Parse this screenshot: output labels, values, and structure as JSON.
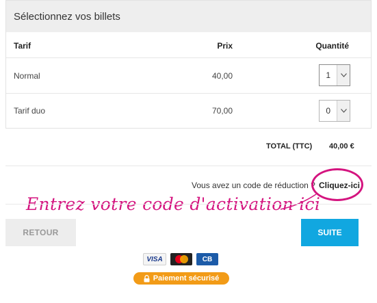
{
  "header": {
    "title": "Sélectionnez vos billets"
  },
  "table": {
    "columns": {
      "tarif": "Tarif",
      "prix": "Prix",
      "quantite": "Quantité"
    },
    "rows": [
      {
        "tarif": "Normal",
        "prix": "40,00",
        "quantite": "1"
      },
      {
        "tarif": "Tarif duo",
        "prix": "70,00",
        "quantite": "0"
      }
    ]
  },
  "total": {
    "label": "TOTAL (TTC)",
    "value": "40,00 €"
  },
  "promo": {
    "text": "Vous avez un code de réduction ?",
    "link": "Cliquez-ici",
    "annotation": "Entrez votre code d'activation ici",
    "annotation_color": "#d4147f"
  },
  "buttons": {
    "back": "RETOUR",
    "next": "SUITE",
    "next_color": "#11a7e0"
  },
  "payment": {
    "cards": [
      "VISA",
      "MasterCard",
      "CB"
    ],
    "secure_label": "Paiement sécurisé",
    "secure_color": "#f29b17",
    "secure_icon": "lock-icon"
  }
}
